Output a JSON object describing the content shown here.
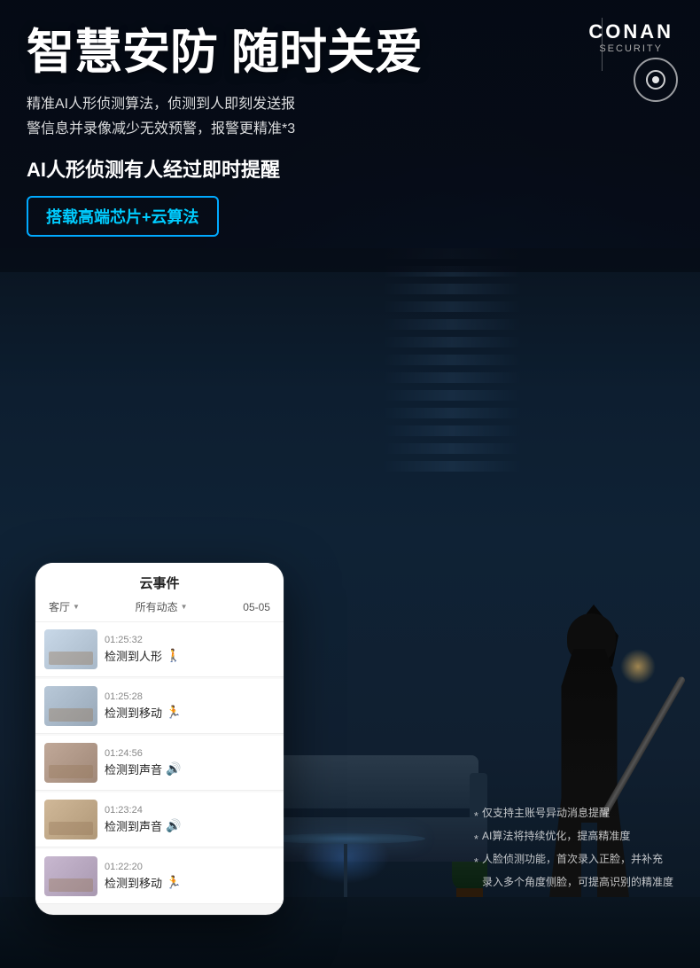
{
  "brand": {
    "name": "CONAN",
    "sub": "SECURITY",
    "divider": true
  },
  "header": {
    "main_title": "智慧安防  随时关爱",
    "description_line1": "精准AI人形侦测算法，侦测到人即刻发送报",
    "description_line2": "警信息并录像减少无效预警，报警更精准*3",
    "sub_title": "AI人形侦测有人经过即时提醒",
    "tag_label": "搭载高端芯片+云算法"
  },
  "phone": {
    "title": "云事件",
    "filter_room": "客厅",
    "filter_state": "所有动态",
    "filter_date": "05-05",
    "events": [
      {
        "time": "01:25:32",
        "desc": "检测到人形",
        "icon_type": "person"
      },
      {
        "time": "01:25:28",
        "desc": "检测到移动",
        "icon_type": "motion"
      },
      {
        "time": "01:24:56",
        "desc": "检测到声音",
        "icon_type": "sound"
      },
      {
        "time": "01:23:24",
        "desc": "检测到声音",
        "icon_type": "sound"
      },
      {
        "time": "01:22:20",
        "desc": "检测到移动",
        "icon_type": "motion"
      }
    ]
  },
  "notes": [
    "* 仅支持主账号异动消息提醒",
    "* AI算法将持续优化，提高精准度",
    "* 人脸侦测功能，首次录入正脸，并补充",
    "   录入多个角度侧脸，可提高识别的精准度"
  ],
  "icons": {
    "person": "🚶",
    "motion": "🏃",
    "sound": "🔊",
    "camera": "⊙"
  }
}
